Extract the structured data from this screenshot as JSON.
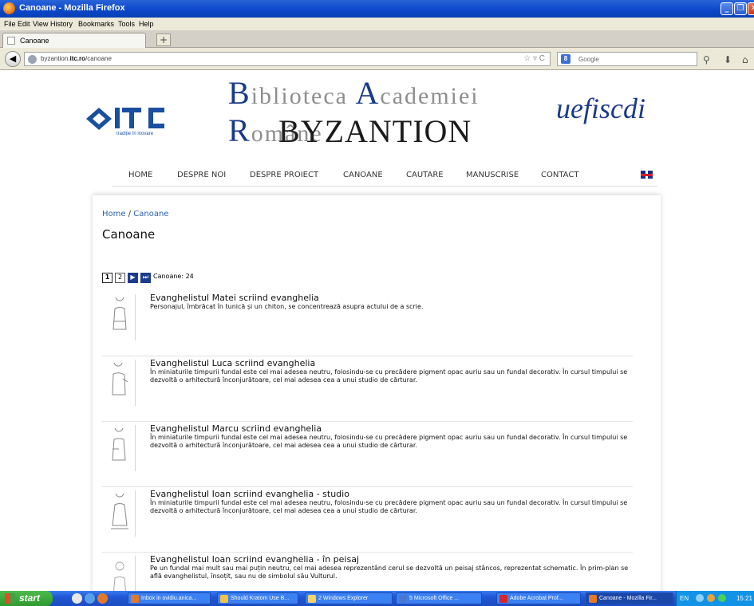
{
  "window": {
    "title": "Canoane - Mozilla Firefox",
    "min": "_",
    "max": "❐",
    "close": "✕"
  },
  "menu": [
    "File",
    "Edit",
    "View",
    "History",
    "Bookmarks",
    "Tools",
    "Help"
  ],
  "tab": {
    "label": "Canoane",
    "new_tab": "+"
  },
  "nav": {
    "back": "◀",
    "url_prefix": "byzantion.",
    "url_domain": "itc.ro",
    "url_path": "/canoane",
    "url_controls": "☆ ▿ C",
    "search_engine": "8",
    "search_placeholder": "Google",
    "search_icon": "⚲",
    "download_icon": "⬇",
    "home_icon": "⌂"
  },
  "header": {
    "itc_tagline": "tradiție în inovare",
    "brand_top": [
      {
        "cap": "B",
        "rest": "iblioteca "
      },
      {
        "cap": "A",
        "rest": "cademiei "
      },
      {
        "cap": "R",
        "rest": "omâne"
      }
    ],
    "brand_main": "BYZANTION",
    "ue_logo": "uefiscdi"
  },
  "main_nav": [
    "HOME",
    "DESPRE NOI",
    "DESPRE PROIECT",
    "CANOANE",
    "CAUTARE",
    "MANUSCRISE",
    "CONTACT"
  ],
  "breadcrumb": {
    "home": "Home",
    "sep": " / ",
    "current": "Canoane"
  },
  "page_title": "Canoane",
  "pager": {
    "pages": [
      "1",
      "2"
    ],
    "next": "▶",
    "last": "⏭",
    "count_label": "Canoane: 24"
  },
  "items": [
    {
      "title": "Evanghelistul Matei scriind evanghelia",
      "desc": "Personajul, îmbrăcat în tunică și un chiton, se concentrează asupra actului de a scrie."
    },
    {
      "title": "Evanghelistul Luca scriind evanghelia",
      "desc": "În miniaturile timpurii fundal este cel mai adesea neutru, folosindu-se cu precădere pigment opac auriu sau un fundal decorativ. În cursul timpului se dezvoltă o arhitectură înconjurătoare, cel mai adesea cea a unui studio de cărturar."
    },
    {
      "title": "Evanghelistul Marcu scriind evanghelia",
      "desc": "În miniaturile timpurii fundal este cel mai adesea neutru, folosindu-se cu precădere pigment opac auriu sau un fundal decorativ. În cursul timpului se dezvoltă o arhitectură înconjurătoare, cel mai adesea cea a unui studio de cărturar."
    },
    {
      "title": "Evanghelistul Ioan scriind evanghelia - studio",
      "desc": "În miniaturile timpurii fundal este cel mai adesea neutru, folosindu-se cu precădere pigment opac auriu sau un fundal decorativ. În cursul timpului se dezvoltă o arhitectură înconjurătoare, cel mai adesea cea a unui studio de cărturar."
    },
    {
      "title": "Evanghelistul Ioan scriind evanghelia - în peisaj",
      "desc": "Pe un fundal mai mult sau mai puțin neutru, cel mai adesea reprezentând cerul se dezvoltă un peisaj stâncos, reprezentat schematic. În prim-plan se află evanghelistul, însoțit, sau nu de simbolul său Vulturul."
    }
  ],
  "taskbar": {
    "start": "start",
    "items": [
      "Inbox in ovidiu.anica...",
      "Should Kratom Use B...",
      "2 Windows Explorer",
      "5 Microsoft Office ...",
      "Adobe Acrobat Prof...",
      "Canoane - Mozilla Fir..."
    ],
    "lang": "EN",
    "clock": "15:21"
  },
  "colors": {
    "link": "#2a5fb0",
    "brand_blue": "#1a3a8a",
    "taskbar": "#2057d6"
  }
}
